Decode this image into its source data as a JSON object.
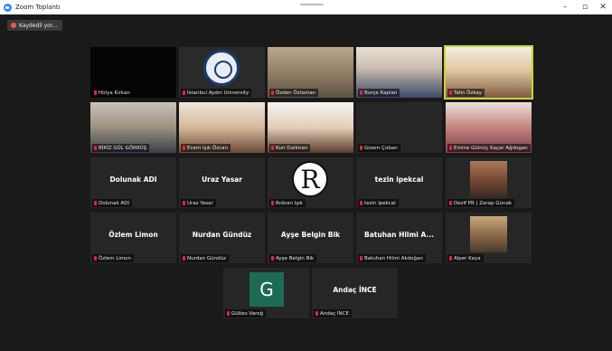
{
  "window": {
    "title": "Zoom Toplantı",
    "minimize": "–",
    "maximize": "▫",
    "close": "✕"
  },
  "recording": {
    "label": "Kaydedil yor..."
  },
  "participants": [
    {
      "name": "Hülya Kırkan"
    },
    {
      "name": "İstanbul Aydın University"
    },
    {
      "name": "Özden Öztaman"
    },
    {
      "name": "Burçe Kaplan"
    },
    {
      "name": "Talin Özkay"
    },
    {
      "name": "BİRİZ GÜL GÖRBÜŞ"
    },
    {
      "name": "Ecem Işık Özcan"
    },
    {
      "name": "Kuri Dalkiran"
    },
    {
      "name": "Gizem Çoban"
    },
    {
      "name": "Emine Gülnüç Kaçar Ağdogan"
    },
    {
      "name": "Dolunak ADI",
      "display": "Dolunak ADI"
    },
    {
      "name": "Uraz Yasar",
      "display": "Uraz Yasar"
    },
    {
      "name": "Rıdvan Işık"
    },
    {
      "name": "tezin ipekcal",
      "display": "tezin ipekcal"
    },
    {
      "name": "Dezif PR | Zarap Günak"
    },
    {
      "name": "Özlem Limon",
      "display": "Özlem Limon"
    },
    {
      "name": "Nurdan Gündüz",
      "display": "Nurdan Gündüz"
    },
    {
      "name": "Ayşe Belgin Bik",
      "display": "Ayşe Belgin Bik"
    },
    {
      "name": "Batuhan Hilmi Akdoğan",
      "display": "Batuhan Hilmi A..."
    },
    {
      "name": "Alper Kaya"
    },
    {
      "name": "Gültes Varoğ",
      "avatar": "G"
    },
    {
      "name": "Andaç İNCE",
      "display": "Andaç İNCE"
    }
  ],
  "r_avatar": "R",
  "colors": {
    "active_speaker": "#c8d43a",
    "muted": "#e22233",
    "avatar_green": "#1e6b55"
  }
}
